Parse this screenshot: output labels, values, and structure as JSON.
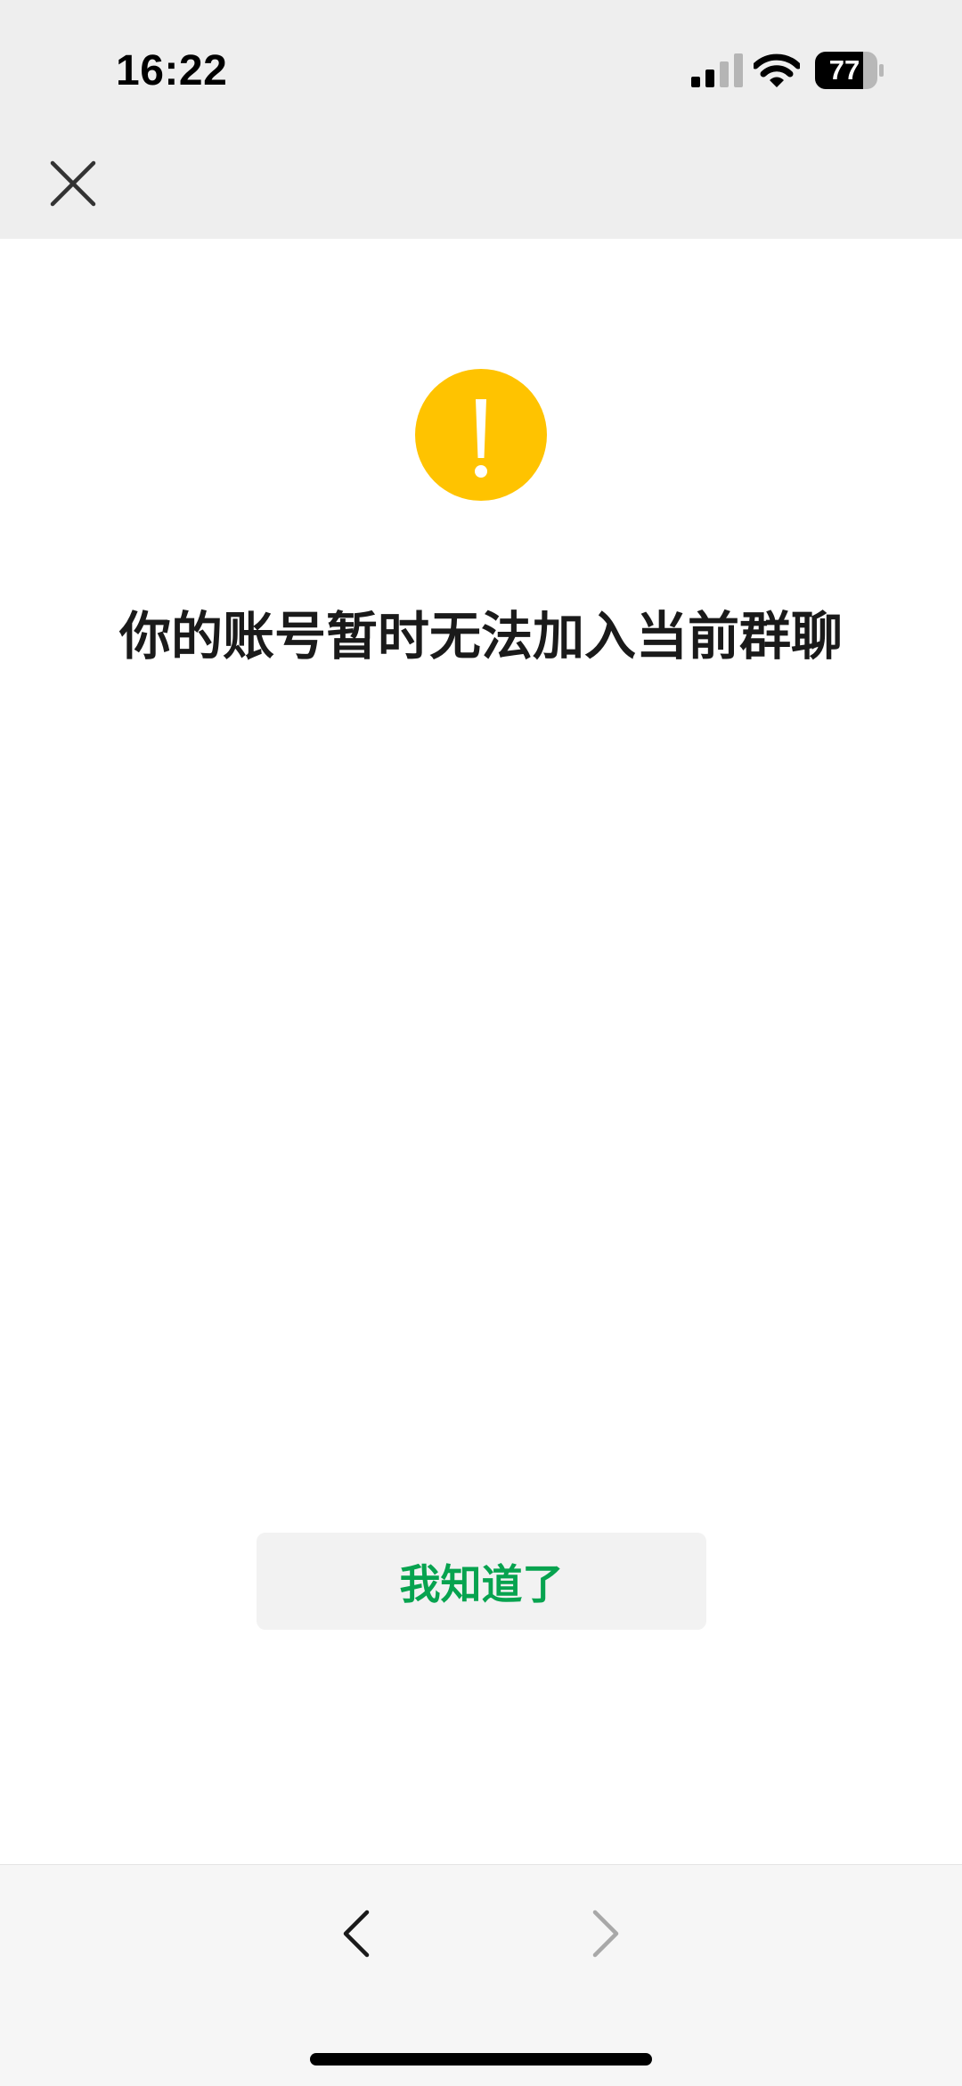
{
  "status_bar": {
    "time": "16:22",
    "battery_level": "77",
    "signal_icon": "cellular-signal-icon",
    "wifi_icon": "wifi-icon",
    "battery_icon": "battery-icon"
  },
  "nav": {
    "close_icon": "close-icon"
  },
  "alert": {
    "icon": "warning-exclamation-icon",
    "icon_color": "#FFC300",
    "message": "你的账号暂时无法加入当前群聊"
  },
  "actions": {
    "confirm_label": "我知道了",
    "confirm_color": "#07A34F"
  },
  "bottom_nav": {
    "back_icon": "chevron-left-icon",
    "forward_icon": "chevron-right-icon",
    "forward_enabled": false
  }
}
